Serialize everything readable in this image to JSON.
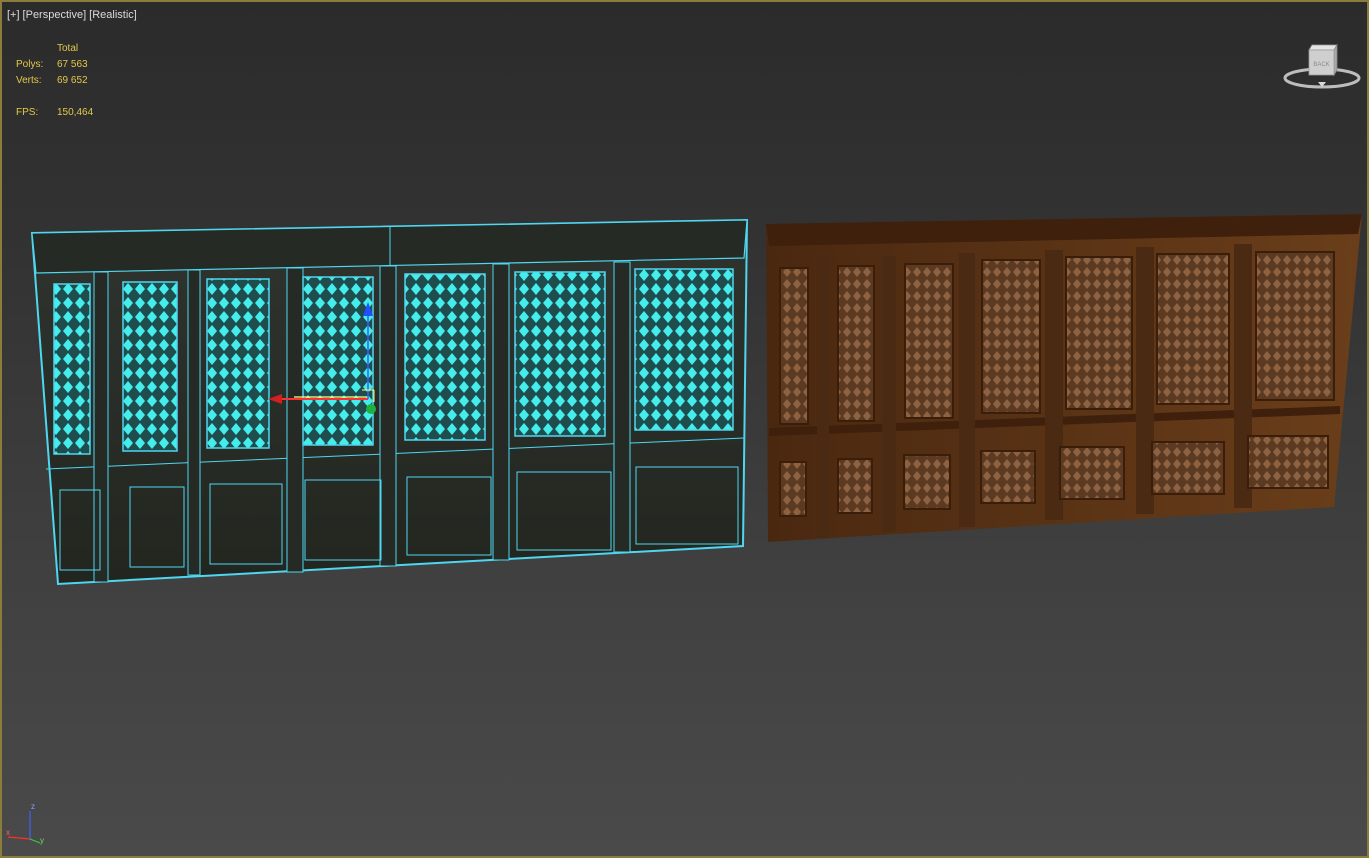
{
  "viewport": {
    "labels": [
      "[+]",
      "[Perspective]",
      "[Realistic]"
    ],
    "border_color": "#8a7d3c"
  },
  "stats": {
    "header": "Total",
    "rows": [
      {
        "label": "Polys:",
        "value": "67 563"
      },
      {
        "label": "Verts:",
        "value": "69 652"
      }
    ],
    "fps_label": "FPS:",
    "fps_value": "150,464",
    "color": "#e4c84c"
  },
  "viewcube": {
    "face": "BACK"
  },
  "axis_tripod": {
    "x": "x",
    "y": "y",
    "z": "z"
  },
  "scene": {
    "selected_panel": {
      "name": "selected-wall-panel",
      "wire_color": "#4fd6f0",
      "glass_color": "#3ee6e6",
      "wood_color": "#2b2e2a"
    },
    "unselected_panel": {
      "name": "wall-panel",
      "wood_color": "#5a3416",
      "grille_color": "#8a5a3a"
    }
  }
}
